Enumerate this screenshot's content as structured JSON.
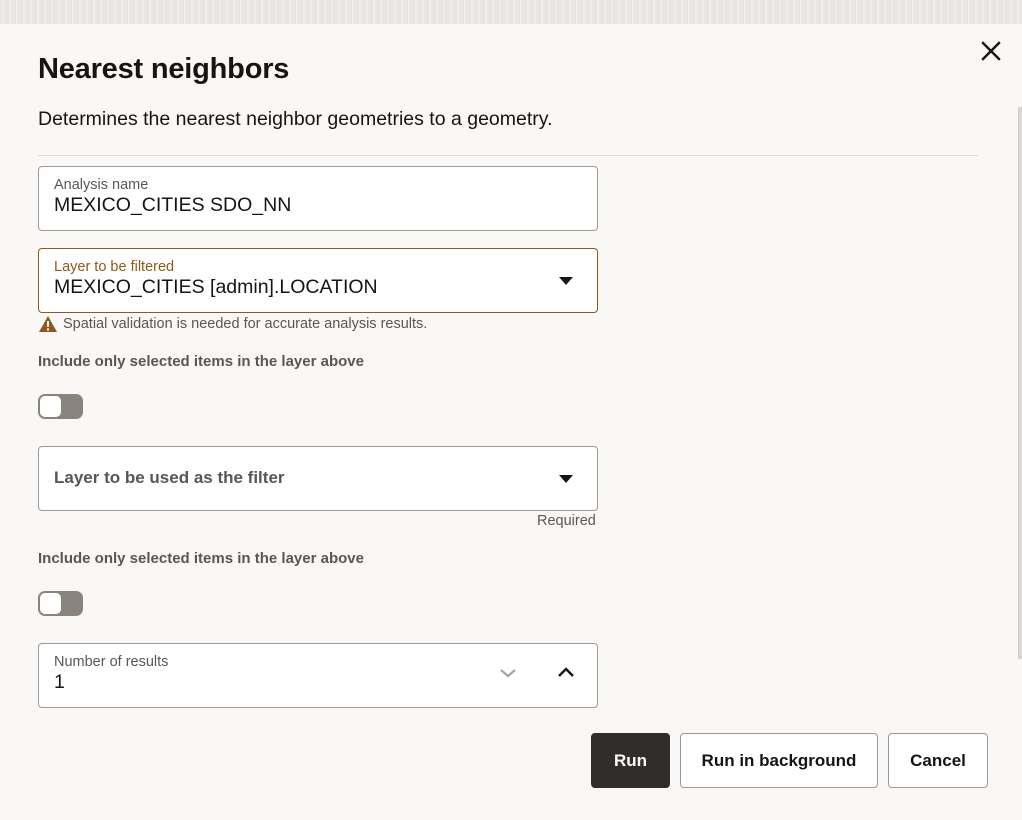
{
  "dialog": {
    "title": "Nearest neighbors",
    "description": "Determines the nearest neighbor geometries to a geometry.",
    "close_icon": "close-icon"
  },
  "form": {
    "analysis_name": {
      "label": "Analysis name",
      "value": "MEXICO_CITIES SDO_NN"
    },
    "layer_to_filter": {
      "label": "Layer to be filtered",
      "value": "MEXICO_CITIES [admin].LOCATION",
      "icon": "caret-down-icon"
    },
    "warning": {
      "icon": "warning-triangle-icon",
      "text": "Spatial validation is needed for accurate analysis results."
    },
    "include_selected_1": {
      "label": "Include only selected items in the layer above",
      "checked": false
    },
    "filter_layer": {
      "placeholder": "Layer to be used as the filter",
      "helper": "Required",
      "icon": "caret-down-icon"
    },
    "include_selected_2": {
      "label": "Include only selected items in the layer above",
      "checked": false
    },
    "number_of_results": {
      "label": "Number of results",
      "value": "1",
      "decrement_icon": "chevron-down-icon",
      "increment_icon": "chevron-up-icon"
    }
  },
  "actions": {
    "run": "Run",
    "run_background": "Run in background",
    "cancel": "Cancel"
  },
  "colors": {
    "accent_focus": "#8f5a17",
    "primary_button": "#312d2a",
    "warning_icon": "#8f5a17",
    "toggle_off": "#8a847e"
  }
}
